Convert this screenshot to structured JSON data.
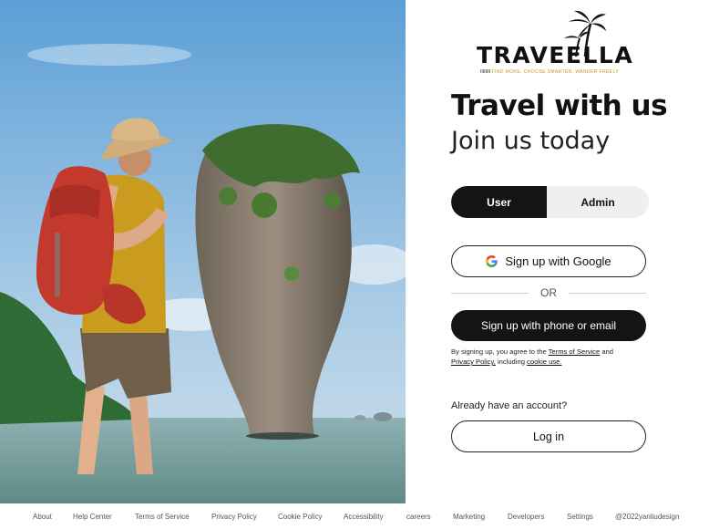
{
  "brand": {
    "name": "TRAVEELLA",
    "tagline": "FIND MORE. CHOOSE SMARTER. WANDER FREELY",
    "accent": "#c79a2a"
  },
  "heading": {
    "title": "Travel with us",
    "subtitle": "Join us today"
  },
  "role_toggle": {
    "options": [
      "User",
      "Admin"
    ],
    "selected": "User"
  },
  "actions": {
    "google_label": "Sign up with Google",
    "or_label": "OR",
    "phone_label": "Sign up with phone or email"
  },
  "terms": {
    "prefix": "By signing up, you agree to the",
    "tos": "Terms of Service",
    "and": "and",
    "privacy": "Privacy Policy,",
    "including": "including",
    "cookie": "cookie use."
  },
  "login": {
    "prompt": "Already have an account?",
    "button": "Log in"
  },
  "footer": {
    "links": [
      "About",
      "Help Center",
      "Terms of Service",
      "Privacy Policy",
      "Cookie Policy",
      "Accessibility",
      "careers",
      "Marketing",
      "Developers",
      "Settings",
      "@2022yanliudesign"
    ]
  },
  "colors": {
    "primary_dark": "#141414",
    "toggle_bg": "#efefef",
    "sky": "#8fbde0",
    "sea": "#7fa3a6"
  }
}
